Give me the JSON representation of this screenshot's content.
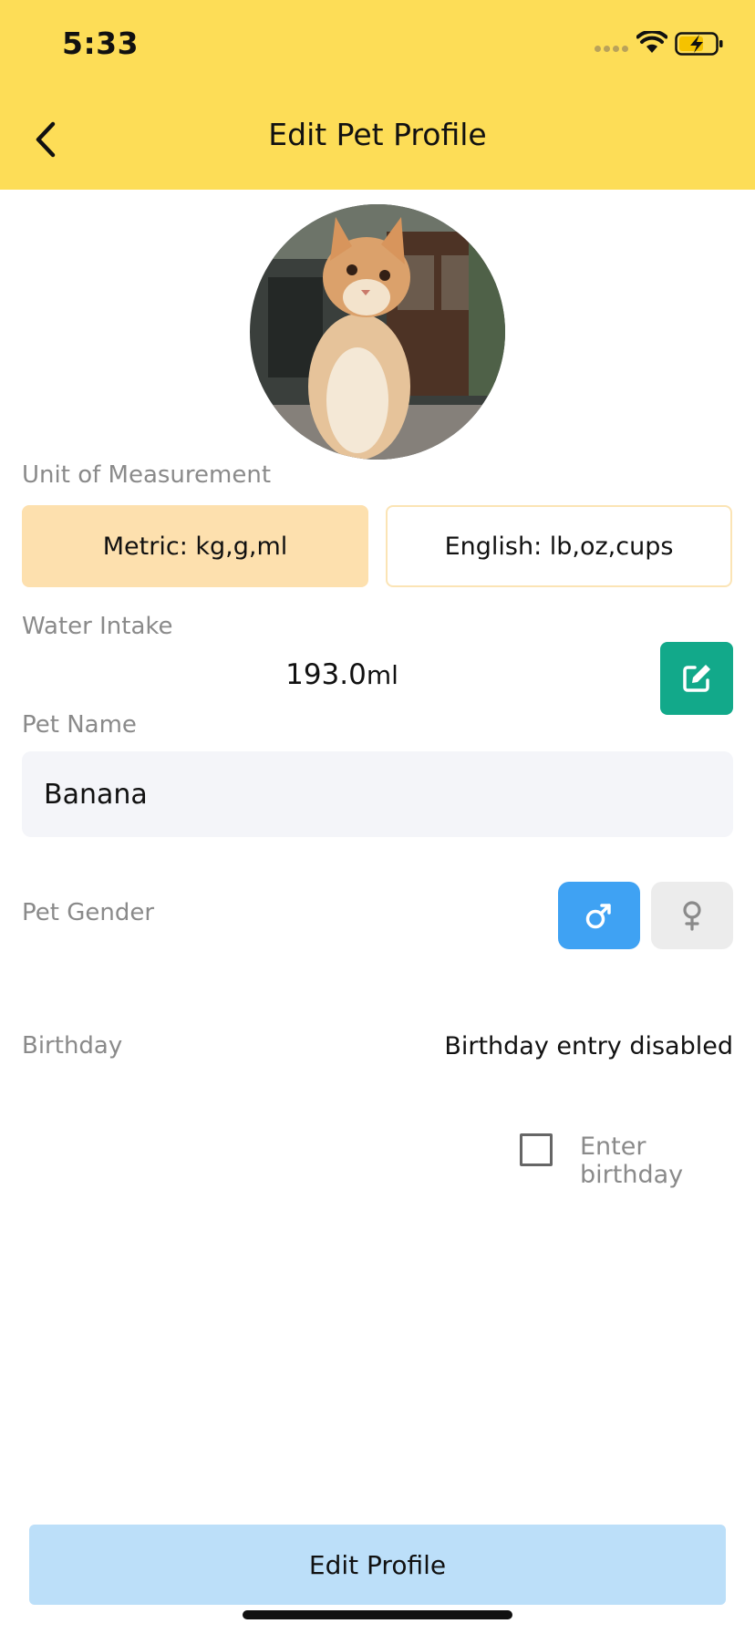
{
  "status_bar": {
    "time": "5:33"
  },
  "header": {
    "title": "Edit Pet Profile"
  },
  "avatar": {
    "alt": "Pet photo: orange kitten"
  },
  "unit": {
    "label": "Unit of Measurement",
    "options": [
      {
        "label": "Metric: kg,g,ml",
        "selected": true
      },
      {
        "label": "English: lb,oz,cups",
        "selected": false
      }
    ]
  },
  "water": {
    "label": "Water Intake",
    "value": "193.0",
    "unit": "ml"
  },
  "pet_name": {
    "label": "Pet Name",
    "value": "Banana"
  },
  "gender": {
    "label": "Pet Gender",
    "selected": "male"
  },
  "birthday": {
    "label": "Birthday",
    "status": "Birthday entry disabled",
    "checkbox_label": "Enter birthday",
    "checked": false
  },
  "submit": {
    "label": "Edit Profile"
  },
  "colors": {
    "header_bg": "#fddd57",
    "metric_selected": "#fde0ae",
    "edit_green": "#12a98a",
    "male_blue": "#3fa2f3",
    "submit_bg": "#bcdff9"
  }
}
